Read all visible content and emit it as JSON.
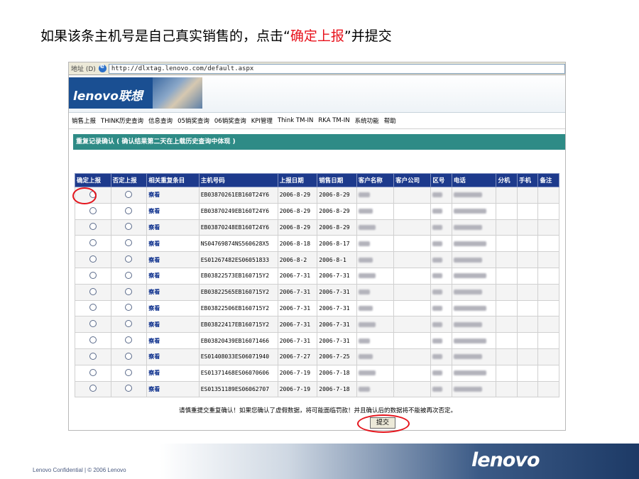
{
  "slide": {
    "title_pre": "如果该条主机号是自己真实销售的，点击“",
    "title_highlight": "确定上报",
    "title_post": "”并提交"
  },
  "browser": {
    "address_label": "地址 (D)",
    "url": "http://dlxtag.lenovo.com/default.aspx"
  },
  "banner": {
    "logo": "lenovo联想"
  },
  "menu": [
    "销售上报",
    "THINK历史查询",
    "信息查询",
    "05销奖查询",
    "06销奖查询",
    "KPI管理",
    "Think TM-IN",
    "RKA TM-IN",
    "系统功能",
    "帮助"
  ],
  "section_title": "重复记录确认 ( 确认结果第二天在上载历史查询中体现 )",
  "table": {
    "headers": [
      "确定上报",
      "否定上报",
      "相关重复条目",
      "主机号码",
      "上报日期",
      "销售日期",
      "客户名称",
      "客户公司",
      "区号",
      "电话",
      "分机",
      "手机",
      "备注"
    ],
    "view_label": "察看",
    "rows": [
      {
        "sn": "EB03870261EB160T24Y6",
        "report": "2006-8-29",
        "sale": "2006-8-29"
      },
      {
        "sn": "EB03870249EB160T24Y6",
        "report": "2006-8-29",
        "sale": "2006-8-29"
      },
      {
        "sn": "EB03870248EB160T24Y6",
        "report": "2006-8-29",
        "sale": "2006-8-29"
      },
      {
        "sn": "NS04769874NS560628X5",
        "report": "2006-8-18",
        "sale": "2006-8-17"
      },
      {
        "sn": "ES01267482ES06051833",
        "report": "2006-8-2",
        "sale": "2006-8-1"
      },
      {
        "sn": "EB03822573EB160715Y2",
        "report": "2006-7-31",
        "sale": "2006-7-31"
      },
      {
        "sn": "EB03822565EB160715Y2",
        "report": "2006-7-31",
        "sale": "2006-7-31"
      },
      {
        "sn": "EB03822506EB160715Y2",
        "report": "2006-7-31",
        "sale": "2006-7-31"
      },
      {
        "sn": "EB03822417EB160715Y2",
        "report": "2006-7-31",
        "sale": "2006-7-31"
      },
      {
        "sn": "EB03820439EB16071466",
        "report": "2006-7-31",
        "sale": "2006-7-31"
      },
      {
        "sn": "ES01408033ES06071940",
        "report": "2006-7-27",
        "sale": "2006-7-25"
      },
      {
        "sn": "ES01371468ES06070606",
        "report": "2006-7-19",
        "sale": "2006-7-18"
      },
      {
        "sn": "ES01351189ES06062707",
        "report": "2006-7-19",
        "sale": "2006-7-18"
      }
    ]
  },
  "notice": "请慎重提交重复确认！如果您确认了虚假数据，将可能面临罚款！并且确认后的数据将不能被再次否定。",
  "submit_label": "提交",
  "footer": {
    "confidential": "Lenovo Confidential | © 2006 Lenovo",
    "logo": "lenovo"
  },
  "colors": {
    "highlight_red": "#e8111b",
    "header_blue": "#1d3a8c",
    "section_teal": "#2e8b86"
  }
}
